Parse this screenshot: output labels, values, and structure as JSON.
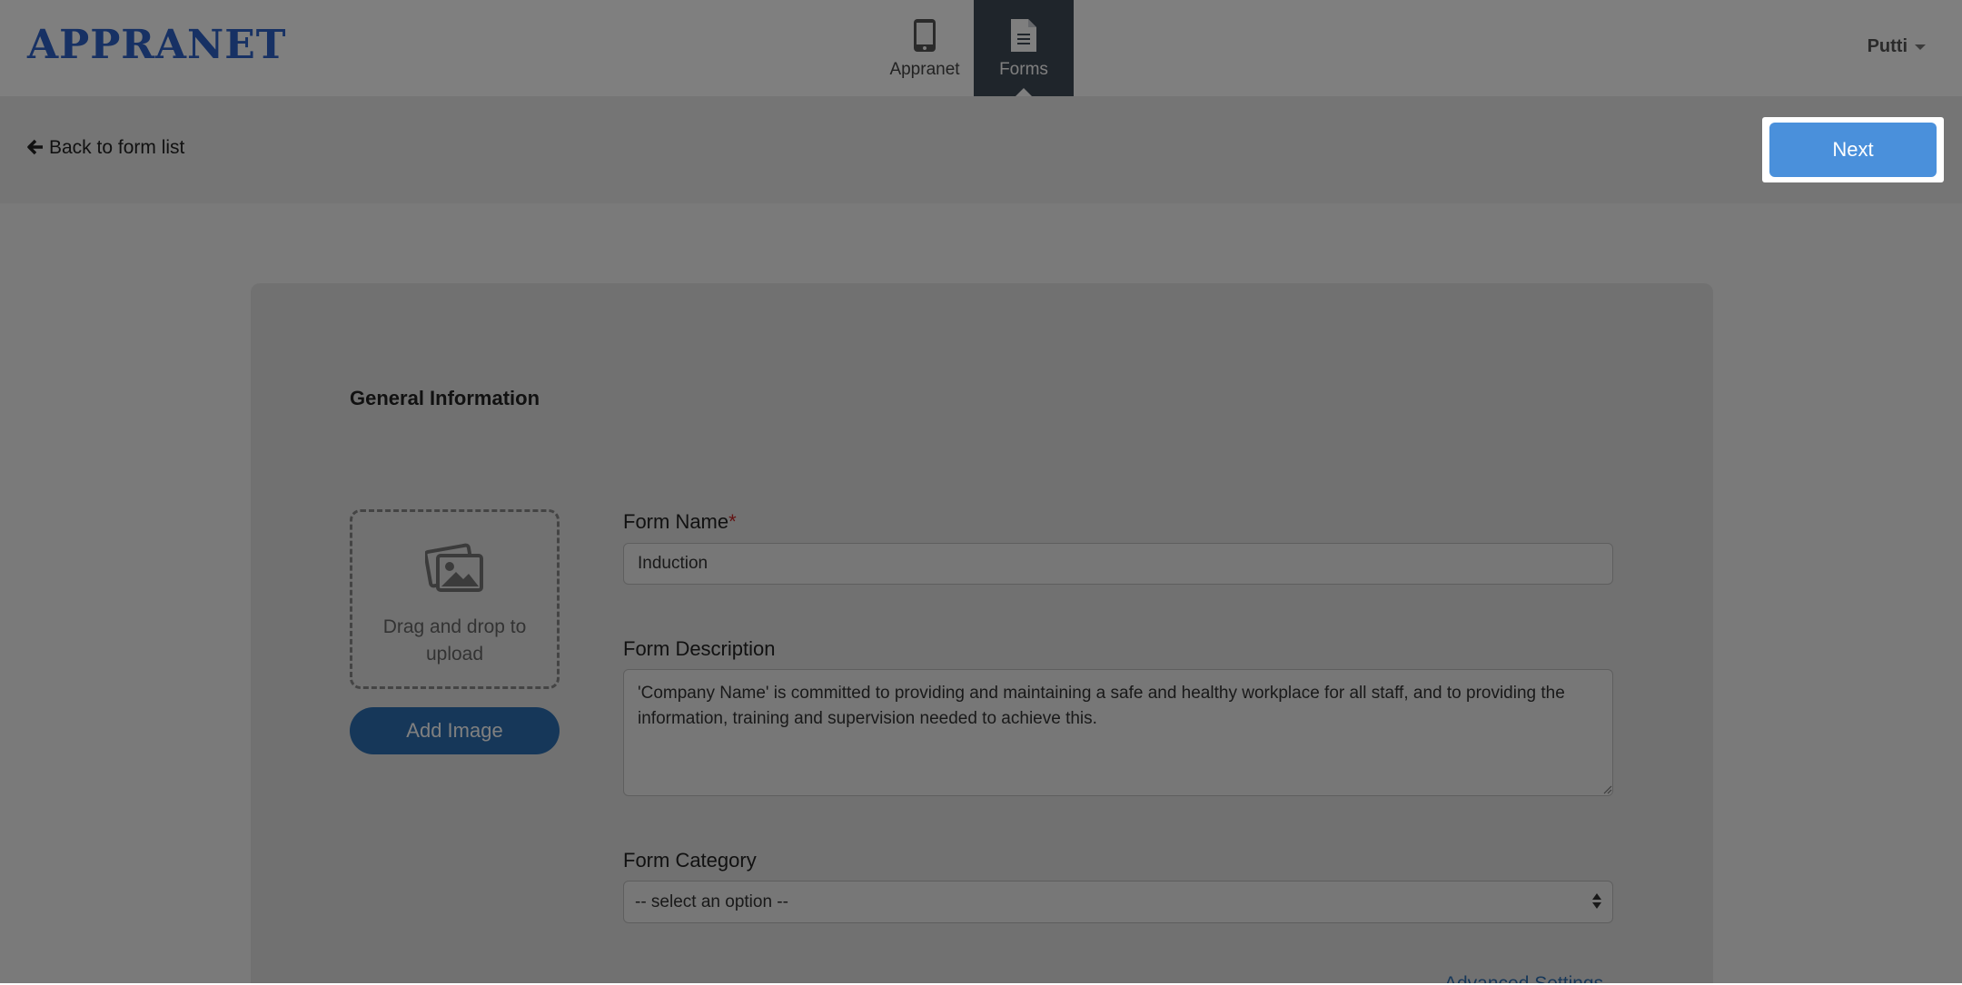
{
  "app": {
    "logo": "APPRANET"
  },
  "nav": {
    "items": [
      {
        "label": "Appranet",
        "icon": "phone-icon",
        "active": false
      },
      {
        "label": "Forms",
        "icon": "document-icon",
        "active": true
      }
    ],
    "user": "Putti"
  },
  "subbar": {
    "back_label": "Back to form list",
    "next_label": "Next"
  },
  "form": {
    "section_title": "General Information",
    "upload": {
      "dropzone_text": "Drag and drop to upload",
      "add_image_label": "Add Image"
    },
    "name": {
      "label": "Form Name",
      "required_mark": "*",
      "value": "Induction"
    },
    "description": {
      "label": "Form Description",
      "value": "'Company Name' is committed to providing and maintaining a safe and healthy workplace for all staff, and to providing the information, training and supervision needed to achieve this."
    },
    "category": {
      "label": "Form Category",
      "selected": "-- select an option --"
    },
    "advanced_settings_label": "Advanced Settings"
  },
  "colors": {
    "brand": "#2f63c9",
    "nav_active": "#3f4a57",
    "primary_button": "#4a90db",
    "add_image_button": "#2d6fb3",
    "required": "#c62828"
  }
}
